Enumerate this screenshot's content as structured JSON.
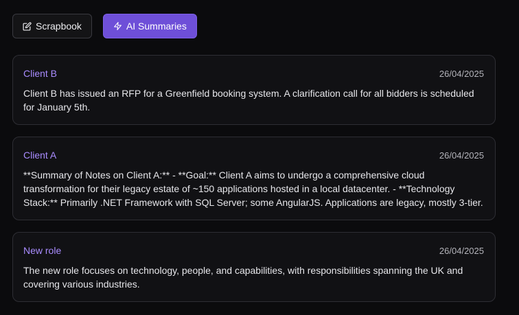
{
  "tabs": [
    {
      "label": "Scrapbook",
      "icon": "edit-icon",
      "active": false
    },
    {
      "label": "AI Summaries",
      "icon": "lightning-icon",
      "active": true
    }
  ],
  "cards": [
    {
      "client": "Client B",
      "date": "26/04/2025",
      "summary": "Client B has issued an RFP for a Greenfield booking system. A clarification call for all bidders is scheduled for January 5th."
    },
    {
      "client": "Client A",
      "date": "26/04/2025",
      "summary": "**Summary of Notes on Client A:** - **Goal:** Client A aims to undergo a comprehensive cloud transformation for their legacy estate of ~150 applications hosted in a local datacenter. - **Technology Stack:** Primarily .NET Framework with SQL Server; some AngularJS. Applications are legacy, mostly 3-tier."
    },
    {
      "client": "New role",
      "date": "26/04/2025",
      "summary": "The new role focuses on technology, people, and capabilities, with responsibilities spanning the UK and covering various industries."
    }
  ],
  "colors": {
    "accent": "#6e4fd8",
    "client_label": "#a98cff",
    "background": "#0b0b0d",
    "card": "#111114"
  }
}
